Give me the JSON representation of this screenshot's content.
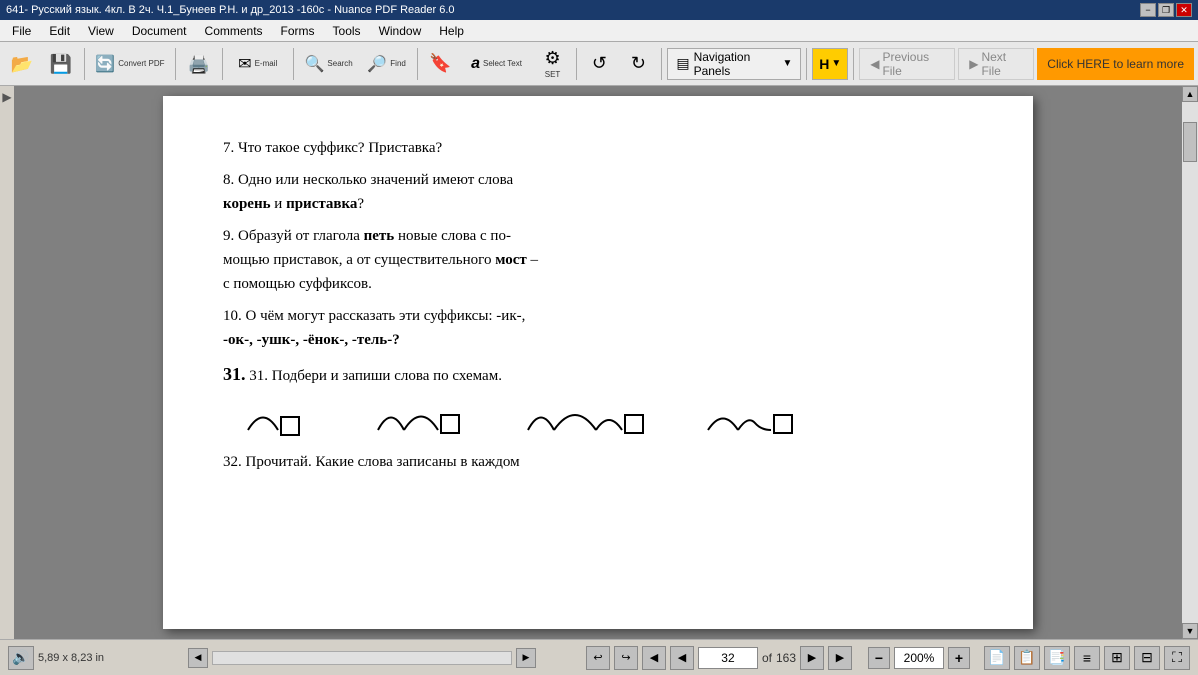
{
  "window": {
    "title": "641- Русский язык. 4кл. В 2ч. Ч.1_Бунеев Р.Н. и др_2013 -160с - Nuance PDF Reader 6.0",
    "min_label": "−",
    "restore_label": "❐",
    "close_label": "✕"
  },
  "menu": {
    "items": [
      "File",
      "Edit",
      "View",
      "Document",
      "Comments",
      "Forms",
      "Tools",
      "Window",
      "Help"
    ]
  },
  "toolbar": {
    "open_label": "Open",
    "save_label": "Save",
    "convert_label": "Convert PDF",
    "print_label": "Print",
    "email_label": "E-mail",
    "search_label": "Search",
    "find_label": "Find",
    "select_text_label": "Select Text",
    "set_label": "SET",
    "undo_label": "↺",
    "redo_label": "↻",
    "nav_panels_label": "Navigation Panels",
    "highlight_label": "H",
    "prev_file_label": "Previous File",
    "next_file_label": "Next File",
    "info_banner": "Click HERE to learn more"
  },
  "content": {
    "q7": "7.  Что  такое  суффикс?  Приставка?",
    "q8_line1": "8.  Одно  или  несколько  значений  имеют  слова",
    "q8_bold": "корень",
    "q8_mid": " и ",
    "q8_bold2": "приставка",
    "q8_end": "?",
    "q9_line1": "9.  Образуй  от  глагола ",
    "q9_bold1": "петь",
    "q9_line1b": " новые  слова  с  по-",
    "q9_line2": "мощью  приставок,  а  от  существительного ",
    "q9_bold2": "мост",
    "q9_dash": " –",
    "q9_line3": "с  помощью  суффиксов.",
    "q10_line1": "10.  О  чём  могут  рассказать  эти  суффиксы:  -ик-,",
    "q10_line2": "-ок-,  -ушк-,  -ёнок-,  -тель-?",
    "q31_line1": "31.  Подбери  и  запиши  слова  по  схемам.",
    "q32_partial": "32.  Прочитай.  Какие  слова  записаны  в  каждом"
  },
  "statusbar": {
    "dimensions": "5,89 x 8,23 in",
    "page_current": "32",
    "page_total": "163",
    "page_display": "32 of 163",
    "zoom": "200%",
    "nav_first": "⏮",
    "nav_prev": "◀",
    "nav_next_page": "▶",
    "nav_last": "⏭",
    "zoom_out": "−",
    "zoom_in": "+"
  }
}
